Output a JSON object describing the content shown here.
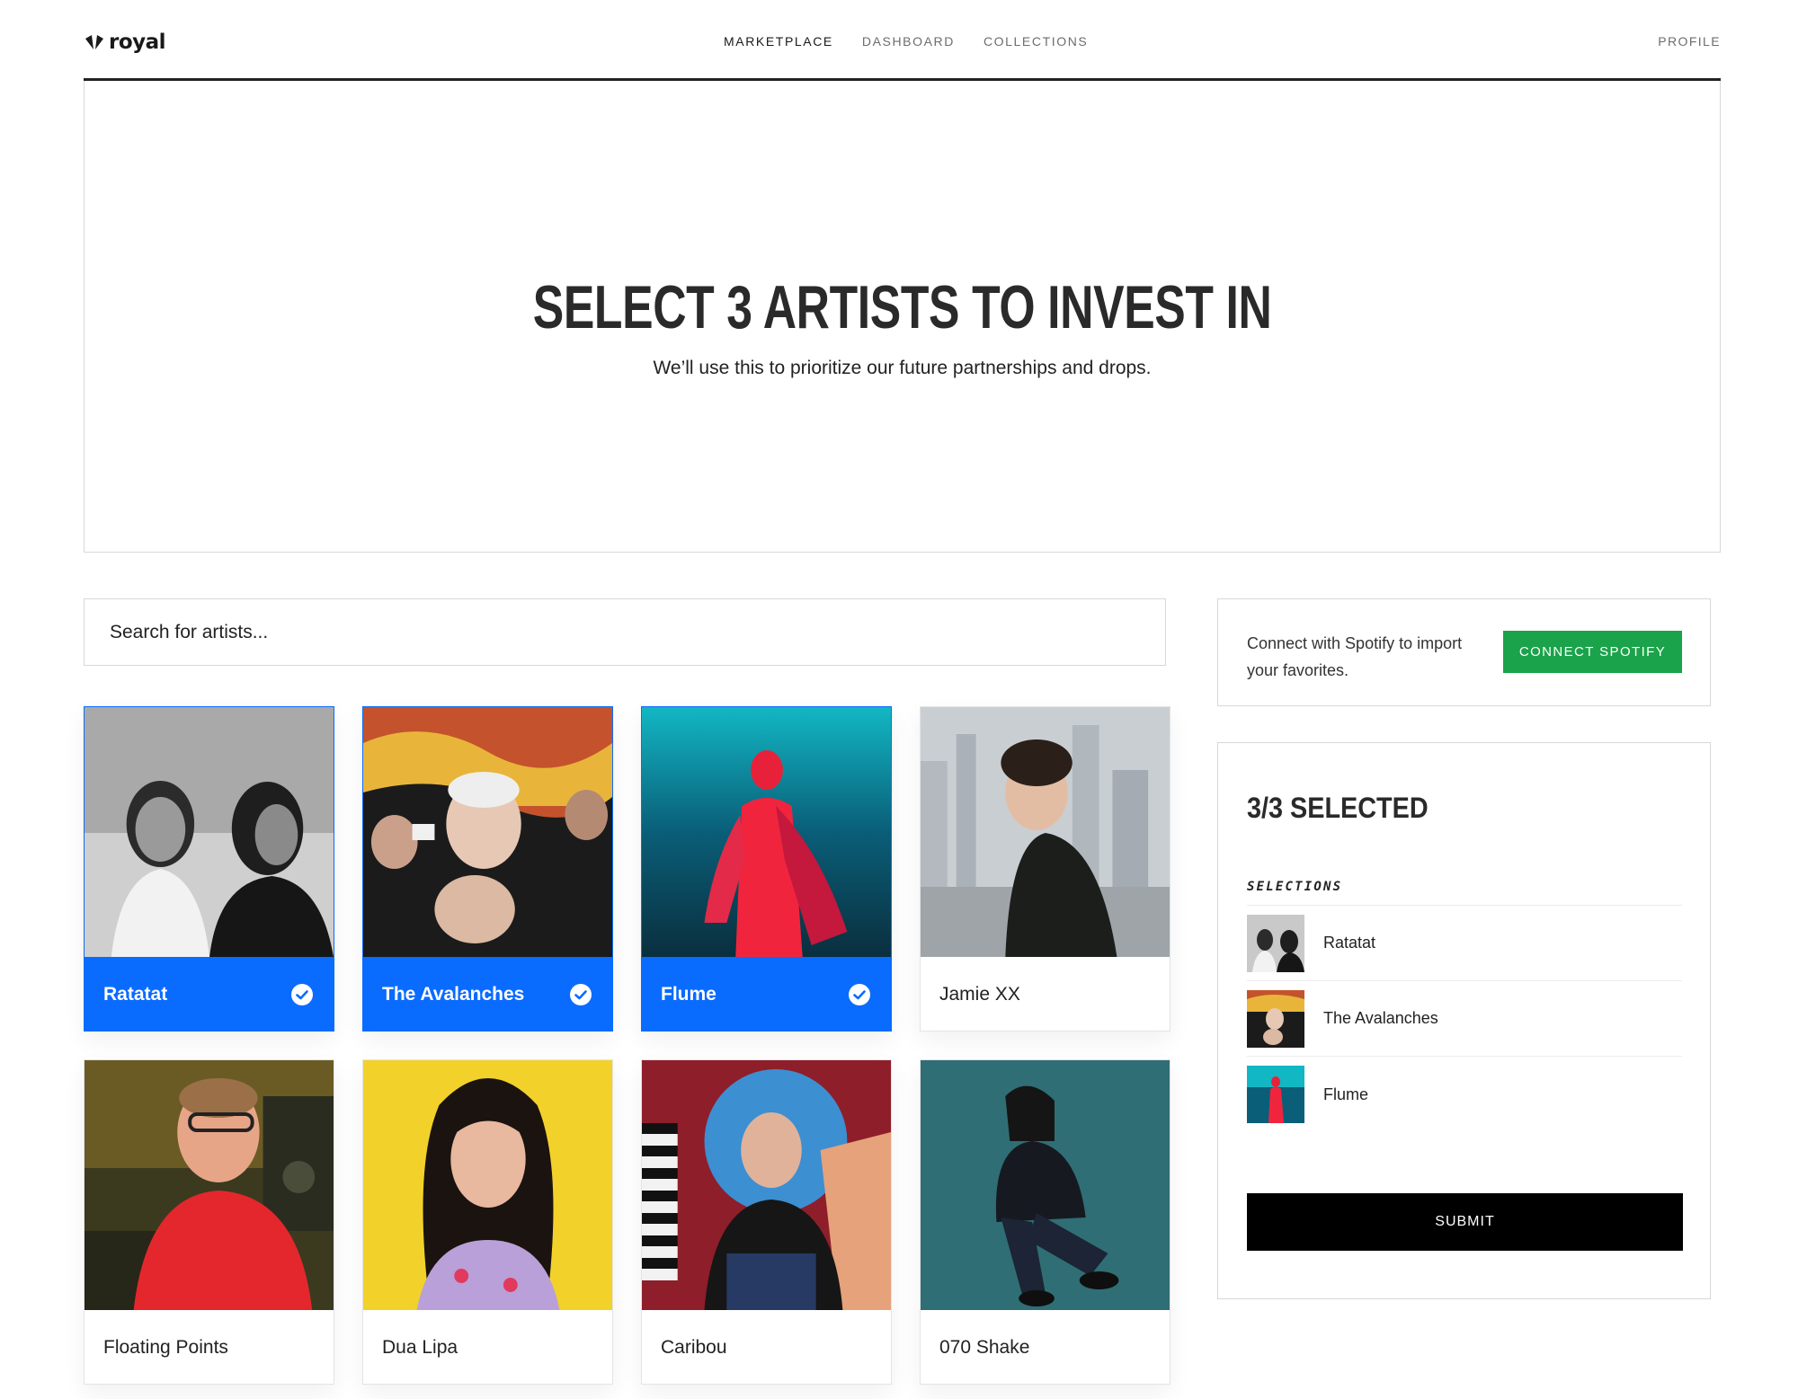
{
  "brand": {
    "name": "royal"
  },
  "nav": {
    "links": [
      {
        "label": "MARKETPLACE",
        "active": true
      },
      {
        "label": "DASHBOARD",
        "active": false
      },
      {
        "label": "COLLECTIONS",
        "active": false
      }
    ],
    "profile": "PROFILE"
  },
  "hero": {
    "title": "SELECT 3 ARTISTS TO INVEST IN",
    "subtitle": "We’ll use this to prioritize our future partnerships and drops."
  },
  "search": {
    "placeholder": "Search for artists..."
  },
  "artists": [
    {
      "name": "Ratatat",
      "selected": true
    },
    {
      "name": "The Avalanches",
      "selected": true
    },
    {
      "name": "Flume",
      "selected": true
    },
    {
      "name": "Jamie XX",
      "selected": false
    },
    {
      "name": "Floating Points",
      "selected": false
    },
    {
      "name": "Dua Lipa",
      "selected": false
    },
    {
      "name": "Caribou",
      "selected": false
    },
    {
      "name": "070 Shake",
      "selected": false
    }
  ],
  "spotify": {
    "text": "Connect with Spotify to import your favorites.",
    "button": "CONNECT SPOTIFY"
  },
  "selection_panel": {
    "count_label": "3/3 SELECTED",
    "heading": "SELECTIONS",
    "items": [
      {
        "name": "Ratatat"
      },
      {
        "name": "The Avalanches"
      },
      {
        "name": "Flume"
      }
    ],
    "submit": "SUBMIT"
  },
  "colors": {
    "accent_blue": "#0a6bff",
    "spotify_green": "#1aa34a",
    "submit_black": "#000000",
    "text_dark": "#222222"
  },
  "icons": {
    "check": "check-circle-icon",
    "logo": "royal-logo-icon"
  }
}
